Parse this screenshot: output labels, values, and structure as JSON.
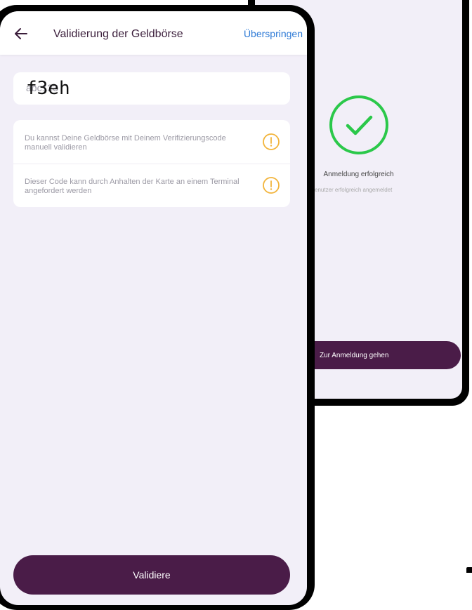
{
  "front_screen": {
    "header": {
      "title": "Validierung der Geldbörse",
      "skip_label": "Überspringen"
    },
    "code_input": {
      "placeholder": "abc123",
      "value": "f3eh"
    },
    "info_items": [
      {
        "text": "Du kannst Deine Geldbörse mit Deinem Verifizierungscode manuell validieren",
        "icon": "exclamation-circle-icon"
      },
      {
        "text": "Dieser Code kann durch Anhalten der Karte an einem Terminal angefordert werden",
        "icon": "exclamation-circle-icon"
      }
    ],
    "validate_button_label": "Validiere"
  },
  "back_screen": {
    "success_title": "Anmeldung erfolgreich",
    "success_subtitle": "Benutzer erfolgreich angemeldet",
    "goto_login_button_label": "Zur Anmeldung gehen",
    "icon": "check-circle-icon"
  },
  "colors": {
    "brand_purple": "#4a1c48",
    "background": "#f2eff8",
    "link_blue": "#2f7bd6",
    "warning_orange": "#f2b43b",
    "success_green": "#2bc84a"
  }
}
